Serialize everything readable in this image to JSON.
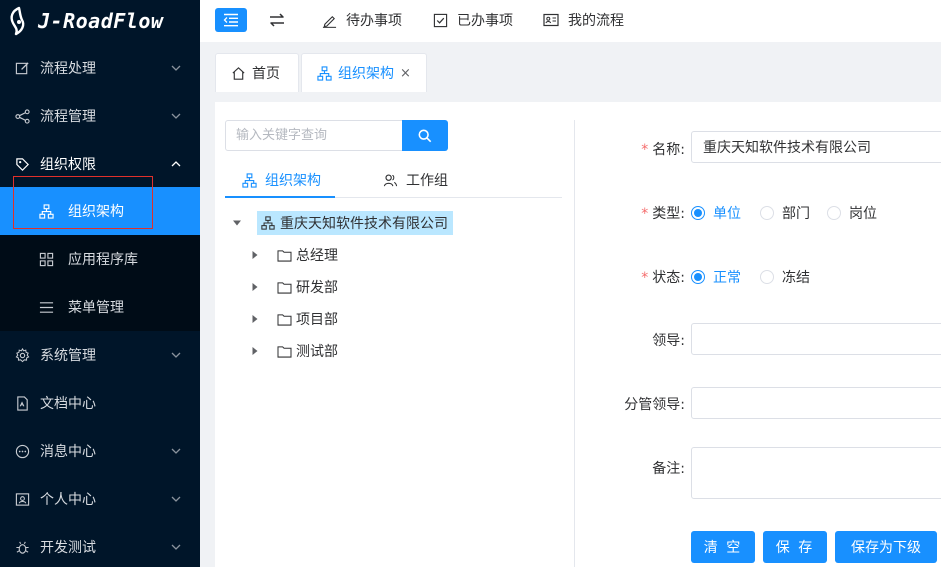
{
  "app": {
    "title": "J-RoadFlow"
  },
  "sidebar": {
    "items": [
      {
        "label": "流程处理",
        "icon": "edit-icon"
      },
      {
        "label": "流程管理",
        "icon": "share-icon"
      },
      {
        "label": "组织权限",
        "icon": "tag-icon",
        "expanded": true
      },
      {
        "label": "系统管理",
        "icon": "gear-icon"
      },
      {
        "label": "文档中心",
        "icon": "document-icon"
      },
      {
        "label": "消息中心",
        "icon": "chat-icon"
      },
      {
        "label": "个人中心",
        "icon": "user-card-icon"
      },
      {
        "label": "开发测试",
        "icon": "bug-icon"
      }
    ],
    "submenu": [
      {
        "label": "组织架构",
        "icon": "org-chart-icon",
        "active": true
      },
      {
        "label": "应用程序库",
        "icon": "grid-icon"
      },
      {
        "label": "菜单管理",
        "icon": "list-icon"
      }
    ]
  },
  "toolbar": {
    "links": [
      {
        "label": "待办事项",
        "icon": "pen-icon"
      },
      {
        "label": "已办事项",
        "icon": "checkbox-icon"
      },
      {
        "label": "我的流程",
        "icon": "id-card-icon"
      }
    ]
  },
  "tabs": [
    {
      "label": "首页",
      "icon": "home-icon"
    },
    {
      "label": "组织架构",
      "icon": "org-chart-icon",
      "active": true,
      "close": "×"
    }
  ],
  "left_panel": {
    "search_placeholder": "输入关键字查询",
    "tabs": [
      {
        "label": "组织架构",
        "active": true
      },
      {
        "label": "工作组"
      }
    ],
    "tree": {
      "root": "重庆天知软件技术有限公司",
      "children": [
        "总经理",
        "研发部",
        "项目部",
        "测试部"
      ]
    }
  },
  "form": {
    "name_label": "名称:",
    "name_value": "重庆天知软件技术有限公司",
    "type_label": "类型:",
    "type_options": [
      "单位",
      "部门",
      "岗位"
    ],
    "type_selected": "单位",
    "status_label": "状态:",
    "status_options": [
      "正常",
      "冻结"
    ],
    "status_selected": "正常",
    "leader_label": "领导:",
    "leader_value": "",
    "charge_leader_label": "分管领导:",
    "charge_leader_value": "",
    "note_label": "备注:",
    "required_mark": "*",
    "buttons": {
      "clear": "清 空",
      "save": "保 存",
      "save_child": "保存为下级"
    }
  },
  "colors": {
    "primary": "#1890ff",
    "sidebar_bg": "#001529",
    "submenu_bg": "#000c17",
    "required": "#f56c6c",
    "tree_selected": "#bae7ff"
  }
}
